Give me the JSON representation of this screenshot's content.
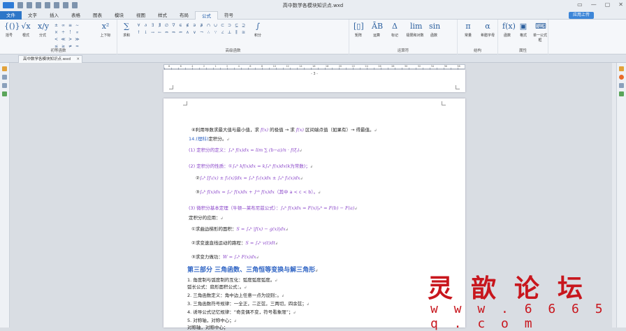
{
  "window": {
    "title": "高中数学各模块知识点.wxd",
    "controls": [
      "▭",
      "—",
      "▢",
      "✕"
    ]
  },
  "menu": {
    "file": "文件",
    "tabs": [
      "文字",
      "插入",
      "表格",
      "图表",
      "模块",
      "视图",
      "样式",
      "布局",
      "公式",
      "符号"
    ],
    "active": "公式",
    "cloud": "应用上传"
  },
  "ribbon": {
    "group1": {
      "label": "初等函数",
      "big_buttons": [
        {
          "glyph": "{()}",
          "label": "括号"
        },
        {
          "glyph": "√x",
          "label": "根式"
        },
        {
          "glyph": "x/y",
          "label": "分式"
        }
      ],
      "small_glyphs": [
        "±",
        "∞",
        "≡",
        "∼",
        "×",
        "÷",
        "!",
        "∝",
        "<",
        "≪",
        ">",
        "≫",
        "≤",
        "≥",
        "≠",
        "≈"
      ],
      "side_button": {
        "glyph": "x²",
        "label": "上下标"
      }
    },
    "group2": {
      "label": "高级函数",
      "big_buttons": [
        {
          "glyph": "∑",
          "label": "求和"
        },
        {
          "glyph": "∫",
          "label": "积分"
        }
      ],
      "small_glyphs": [
        "∀",
        "∂",
        "∃",
        "∄",
        "∅",
        "∇",
        "∈",
        "∉",
        "∋",
        "∌",
        "∩",
        "∪",
        "⊂",
        "⊃",
        "⊆",
        "⊇",
        "↑",
        "↓",
        "→",
        "←",
        "⇔",
        "⇒",
        "⇐",
        "∧",
        "∨",
        "¬",
        "∴",
        "∵",
        "∠",
        "⊥",
        "∥",
        "≅"
      ]
    },
    "group3": {
      "label": "运算符",
      "big_buttons": [
        {
          "glyph": "[▯]",
          "label": "矩阵"
        },
        {
          "glyph": "ĀB",
          "label": "运算"
        },
        {
          "glyph": "Δ",
          "label": "标记"
        },
        {
          "glyph": "lim",
          "label": "极限和对数"
        },
        {
          "glyph": "sin",
          "label": "函数"
        }
      ]
    },
    "group4": {
      "label": "结构",
      "big_buttons": [
        {
          "glyph": "π",
          "label": "常量"
        },
        {
          "glyph": "α",
          "label": "希腊字母"
        }
      ]
    },
    "group5": {
      "label": "属性",
      "big_buttons": [
        {
          "glyph": "f(x)",
          "label": "函数"
        },
        {
          "glyph": "▣",
          "label": "格式"
        },
        {
          "glyph": "⌨",
          "label": "单一公式框"
        }
      ]
    }
  },
  "doc_tab": {
    "name": "高中数学各模块知识点.wxd",
    "close": "✕"
  },
  "ruler": {
    "numbers": [
      "8",
      "6",
      "4",
      "2",
      "1",
      "2",
      "4",
      "6",
      "8",
      "10",
      "12",
      "14",
      "16",
      "18",
      "20",
      "22",
      "24",
      "26",
      "28",
      "30",
      "32",
      "34",
      "36",
      "38"
    ]
  },
  "page_top": {
    "page_number": "- 3 -"
  },
  "document": {
    "lines": [
      {
        "text": "④利用导数求最大值与最小值，求 ",
        "formula": "f(x)",
        "text2": " 的极值 → 求 ",
        "formula2": "f(x)",
        "text3": " 区间端点值（如果有）→ 得最值。"
      },
      {
        "blue": "14.(理科)",
        "text": "定积分。"
      },
      {
        "text": "(1) 定积分的定义：",
        "formula": "∫ₐᵇ f(x)dx = lim ∑ (b−a)/n · f(ξᵢ)"
      },
      {
        "text": "(2) 定积分的性质：①",
        "formula": "∫ₐᵇ kf(x)dx = k∫ₐᵇ f(x)dx",
        "text2": "(k为常数)；"
      },
      {
        "text": "②",
        "formula": "∫ₐᵇ [f₁(x) ± f₂(x)]dx = ∫ₐᵇ f₁(x)dx ± ∫ₐᵇ f₂(x)dx"
      },
      {
        "text": "③",
        "formula": "∫ₐᵇ f(x)dx = ∫ₐᶜ f(x)dx + ∫ᶜᵇ f(x)dx",
        "text2": "（其中 a < c < b）。"
      },
      {
        "text": "(3) 微积分基本定理（牛顿—莱布尼兹公式）：",
        "formula": "∫ₐᵇ f(x)dx = F(x)|ₐᵇ = F(b) − F(a)"
      },
      {
        "text": "定积分的应用："
      },
      {
        "text": "①求曲边梯形的面积：",
        "formula": "S = ∫ₐᵇ |f(x) − g(x)|dx"
      },
      {
        "text": "②求变速直线运动的路程：",
        "formula": "S = ∫ₐᵇ v(t)dt"
      },
      {
        "text": "③求变力做功：",
        "formula": "W = ∫ₐᵇ F(x)dx"
      }
    ],
    "heading": "第三部分    三角函数、三角恒等变换与解三角形",
    "list": [
      "1. 角度制与弧度制的互化：弧度弧度弧度。",
      "弧长公式：扇形面积公式：。",
      "2. 三角函数定义：角中边上任意一点为设则：。",
      "3. 三角函数符号规律：一全正，二正弦，三两切，四余弦；",
      "4. 诱导公式记忆规律：“奇变偶不变，符号看象限”；",
      "5. 对称轴，对称中心；",
      "对称轴，对称中心；"
    ],
    "mark": "↲"
  },
  "watermark": {
    "chars": [
      "灵",
      "歆",
      "论",
      "坛"
    ],
    "url": "w w w . 6 6 6 5 q . c o m"
  },
  "colors": {
    "file_tab": "#2d76c8",
    "formula": "#8a46c9",
    "heading": "#2f64c4",
    "watermark": "#c8161d"
  }
}
